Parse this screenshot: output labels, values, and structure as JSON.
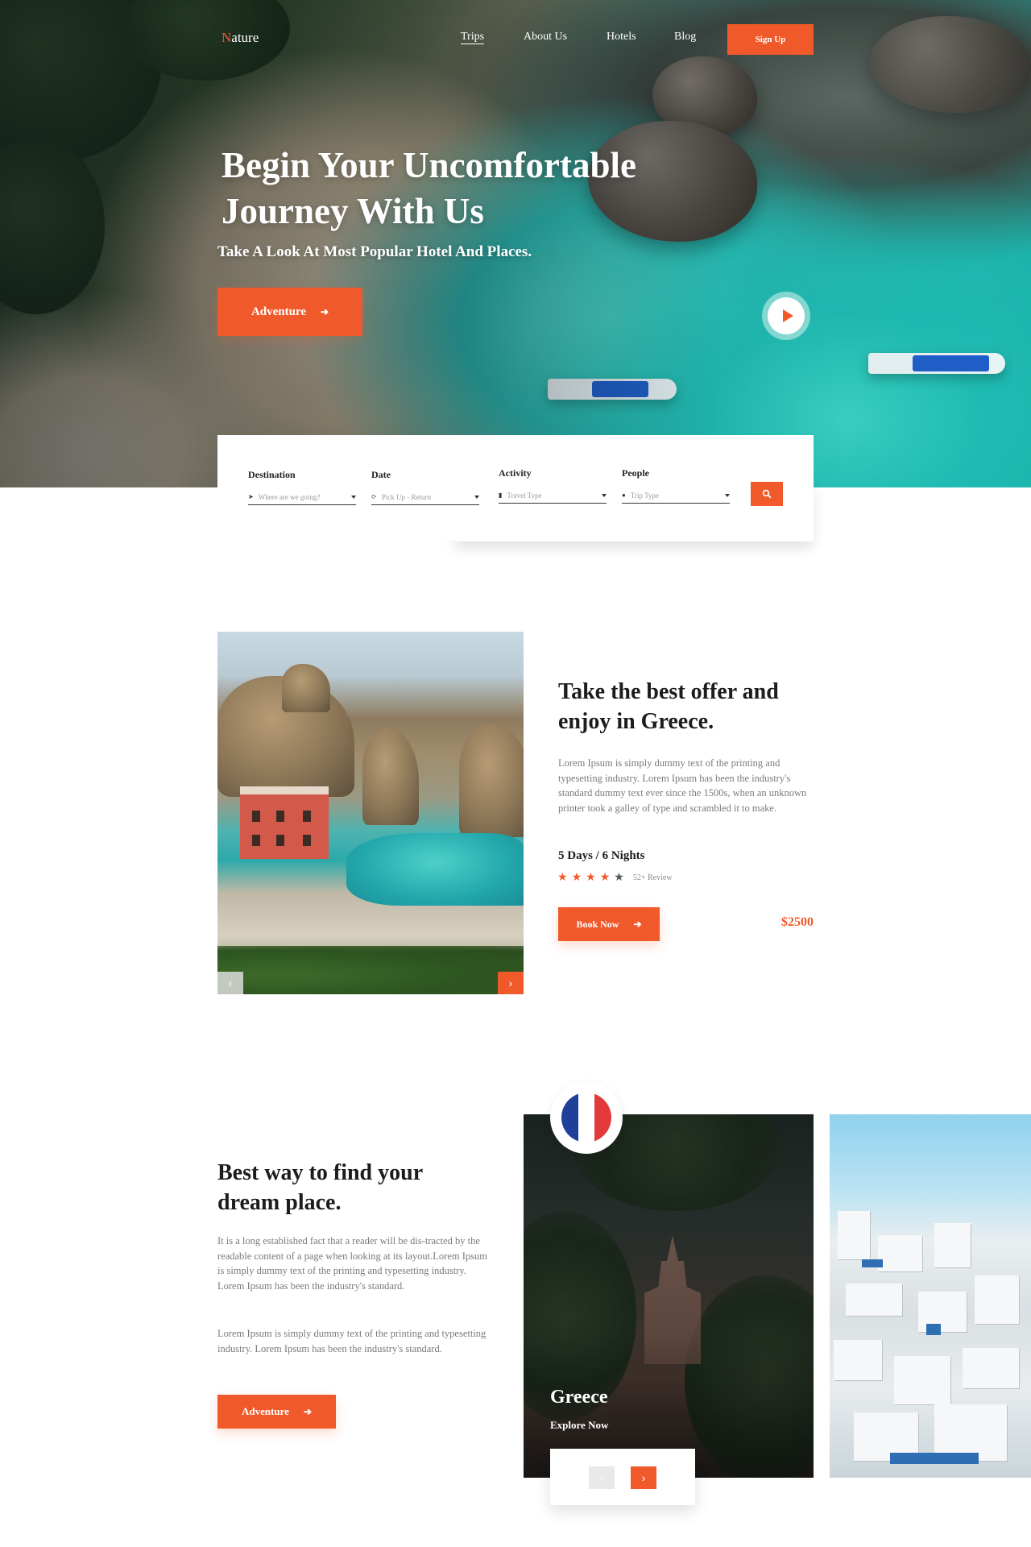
{
  "nav": {
    "logo_first": "N",
    "logo_rest": "ature",
    "links": [
      "Trips",
      "About Us",
      "Hotels",
      "Blog"
    ],
    "signup": "Sign Up"
  },
  "hero": {
    "title": "Begin Your Uncomfortable Journey With Us",
    "subtitle": "Take A Look At Most Popular Hotel And Places.",
    "cta": "Adventure",
    "play_icon": "play-icon"
  },
  "search": {
    "fields": [
      {
        "label": "Destination",
        "placeholder": "Where are we going?",
        "icon": "location-arrow-icon"
      },
      {
        "label": "Date",
        "placeholder": "Pick Up - Return",
        "icon": "refresh-icon"
      },
      {
        "label": "Activity",
        "placeholder": "Travel Type",
        "icon": "bookmark-icon"
      },
      {
        "label": "People",
        "placeholder": "Trip Type",
        "icon": "person-icon"
      }
    ],
    "button_icon": "search-icon"
  },
  "offer": {
    "title": "Take the best offer and enjoy in Greece.",
    "text": "Lorem Ipsum is simply dummy text of the printing and typesetting industry. Lorem Ipsum has been the industry's standard dummy text ever since the 1500s, when an unknown printer took a galley of type and scrambled it to make.",
    "duration": "5 Days / 6 Nights",
    "rating": 4,
    "rating_max": 5,
    "reviews": "52+ Review",
    "cta": "Book Now",
    "price": "$2500"
  },
  "dream": {
    "title": "Best way to find your dream place.",
    "text1": "It is a long established fact that a reader will be dis-tracted by the readable content of a page when looking at its layout.Lorem Ipsum is simply dummy text of the printing and typesetting industry. Lorem Ipsum has been the industry's standard.",
    "text2": "Lorem Ipsum is simply dummy text of the printing and typesetting industry. Lorem Ipsum has been the industry's standard.",
    "cta": "Adventure"
  },
  "destination_card": {
    "name": "Greece",
    "cta": "Explore Now",
    "flag_colors": [
      "#1f3f9a",
      "#ffffff",
      "#e23a3a"
    ]
  },
  "colors": {
    "accent": "#f05a2b",
    "text_dark": "#1c1c1c",
    "text_muted": "#7a7a7a"
  }
}
